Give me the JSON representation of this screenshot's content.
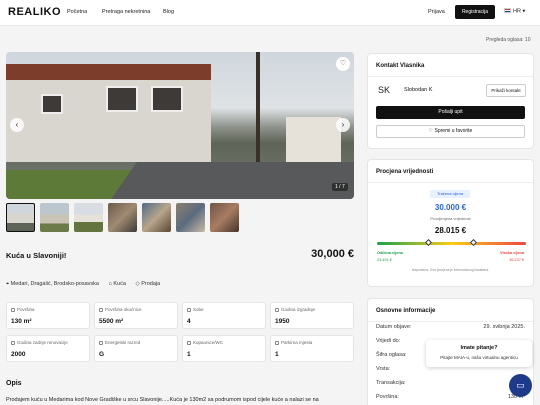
{
  "header": {
    "logo": "REALIKO",
    "nav": [
      "Početna",
      "Pretraga nekretnina",
      "Blog"
    ],
    "login": "Prijava",
    "register": "Registracija",
    "lang": "HR"
  },
  "views": "Pregleda oglasa: 10",
  "gallery": {
    "counter": "1 / 7"
  },
  "listing": {
    "title": "Kuća u Slavoniji!",
    "price": "30,000 €",
    "location": "Medari, Dragalić, Brodsko-posavska",
    "type": "Kuća",
    "deal": "Prodaja"
  },
  "stats": [
    {
      "label": "Površina",
      "value": "130 m²"
    },
    {
      "label": "Površina okućnice",
      "value": "5500 m²"
    },
    {
      "label": "Sobe",
      "value": "4"
    },
    {
      "label": "Godina izgradnje",
      "value": "1950"
    },
    {
      "label": "Godina zadnje renovacije",
      "value": "2000"
    },
    {
      "label": "Energetski razred",
      "value": "G"
    },
    {
      "label": "Kupaonice/WC",
      "value": "1"
    },
    {
      "label": "Parkirna mjesta",
      "value": "1"
    }
  ],
  "description": {
    "heading": "Opis",
    "text": "Prodajem kuću u Medarima kod Nove Gradiške u srcu Slavonije.....Kuća je 130m2 sa podrumom ispod cijele kuće a nalazi se na"
  },
  "contact": {
    "heading": "Kontakt Vlasnika",
    "initials": "SK",
    "name": "Slobodan K",
    "show_contact": "Prikaži kontakt",
    "send_inquiry": "Pošalji upit",
    "save_favorite": "Spremi u favorite"
  },
  "valuation": {
    "heading": "Procjena vrijednosti",
    "asked_label": "Tražena cijena",
    "asked_value": "30.000 €",
    "estimated_label": "Procijenjena vrijednost",
    "estimated_value": "28.015 €",
    "low_label": "Odlična cijena",
    "low_value": "23.491 €",
    "high_label": "Visoka cijena",
    "high_value": "36.237 €",
    "note": "Napomena: Ova procjena je informativnog karaktera.",
    "gauge_colors": [
      "#16a34a",
      "#facc15",
      "#ef4444"
    ]
  },
  "info": {
    "heading": "Osnovne informacije",
    "rows": [
      {
        "k": "Datum objave:",
        "v": "29. svibnja 2025."
      },
      {
        "k": "Vrijedi do:",
        "v": ""
      },
      {
        "k": "Šifra oglasa:",
        "v": ""
      },
      {
        "k": "Vrsta:",
        "v": ""
      },
      {
        "k": "Transakcija:",
        "v": "P"
      },
      {
        "k": "Površina:",
        "v": "130 m²"
      }
    ]
  },
  "chat": {
    "title": "Imate pitanje?",
    "subtitle": "Pitajte MAIA-u, našu virtualnu agenticu"
  }
}
